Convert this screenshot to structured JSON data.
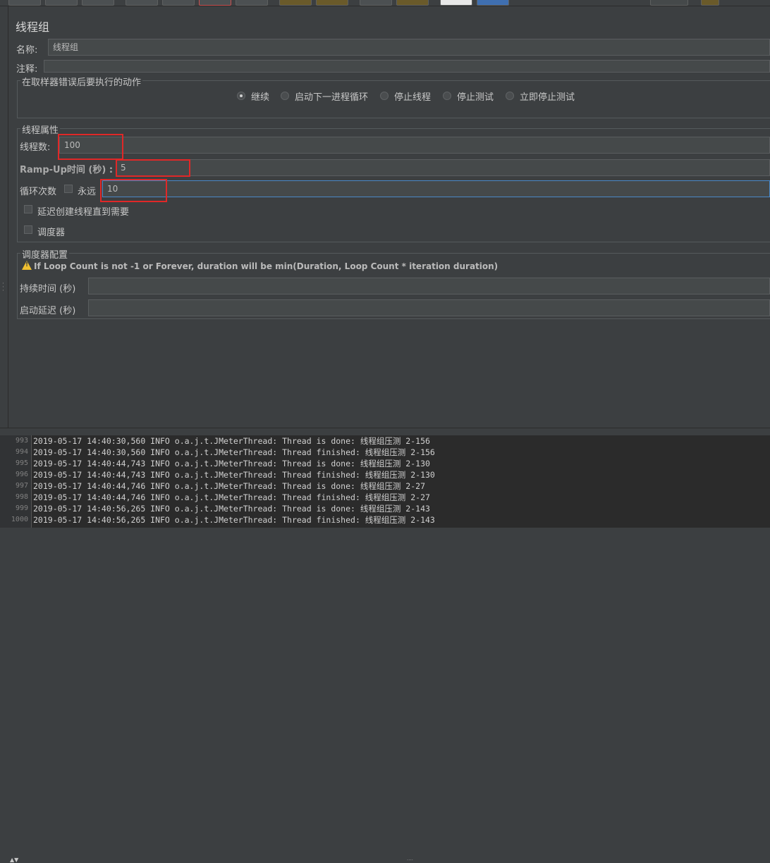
{
  "panel": {
    "title": "线程组"
  },
  "name_row": {
    "label": "名称:",
    "value": "线程组"
  },
  "comment_row": {
    "label": "注释:",
    "value": ""
  },
  "error_action": {
    "legend": "在取样器错误后要执行的动作",
    "options": [
      {
        "label": "继续",
        "checked": true
      },
      {
        "label": "启动下一进程循环",
        "checked": false
      },
      {
        "label": "停止线程",
        "checked": false
      },
      {
        "label": "停止测试",
        "checked": false
      },
      {
        "label": "立即停止测试",
        "checked": false
      }
    ]
  },
  "thread_props": {
    "legend": "线程属性",
    "threads_label": "线程数:",
    "threads_value": "100",
    "rampup_label": "Ramp-Up时间 (秒) :",
    "rampup_value": "5",
    "loop_label": "循环次数",
    "forever_label": "永远",
    "forever_checked": false,
    "loop_value": "10",
    "delay_label": "延迟创建线程直到需要",
    "delay_checked": false,
    "scheduler_label": "调度器",
    "scheduler_checked": false
  },
  "scheduler_config": {
    "legend": "调度器配置",
    "warning": "If Loop Count is not -1 or Forever, duration will be min(Duration, Loop Count * iteration duration)",
    "duration_label": "持续时间 (秒)",
    "duration_value": "",
    "startup_delay_label": "启动延迟 (秒)",
    "startup_delay_value": ""
  },
  "log": {
    "lines": [
      {
        "num": "993",
        "text": "2019-05-17 14:40:30,560 INFO o.a.j.t.JMeterThread: Thread is done: 线程组压测 2-156"
      },
      {
        "num": "994",
        "text": "2019-05-17 14:40:30,560 INFO o.a.j.t.JMeterThread: Thread finished: 线程组压测 2-156"
      },
      {
        "num": "995",
        "text": "2019-05-17 14:40:44,743 INFO o.a.j.t.JMeterThread: Thread is done: 线程组压测 2-130"
      },
      {
        "num": "996",
        "text": "2019-05-17 14:40:44,743 INFO o.a.j.t.JMeterThread: Thread finished: 线程组压测 2-130"
      },
      {
        "num": "997",
        "text": "2019-05-17 14:40:44,746 INFO o.a.j.t.JMeterThread: Thread is done: 线程组压测 2-27"
      },
      {
        "num": "998",
        "text": "2019-05-17 14:40:44,746 INFO o.a.j.t.JMeterThread: Thread finished: 线程组压测 2-27"
      },
      {
        "num": "999",
        "text": "2019-05-17 14:40:56,265 INFO o.a.j.t.JMeterThread: Thread is done: 线程组压测 2-143"
      },
      {
        "num": "1000",
        "text": "2019-05-17 14:40:56,265 INFO o.a.j.t.JMeterThread: Thread finished: 线程组压测 2-143"
      }
    ]
  },
  "colors": {
    "background": "#3c3f41",
    "field": "#45494a",
    "highlight_box": "#e02828",
    "focus": "#4a88c7",
    "warning": "#f0c030"
  }
}
